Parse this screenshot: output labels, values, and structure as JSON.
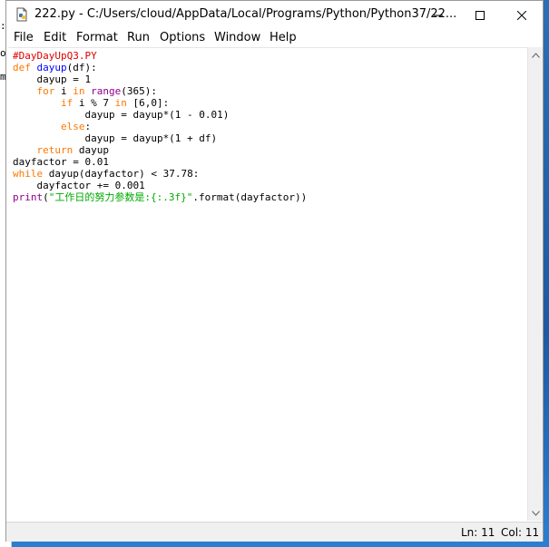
{
  "window": {
    "title": "222.py - C:/Users/cloud/AppData/Local/Programs/Python/Python37/22...",
    "icon": "python-file-icon"
  },
  "background_window": {
    "fragments": [
      ":",
      "o",
      "ma"
    ]
  },
  "menu": [
    "File",
    "Edit",
    "Format",
    "Run",
    "Options",
    "Window",
    "Help"
  ],
  "code_lines": [
    [
      {
        "t": "#DayDayUpQ3.PY",
        "c": "cm"
      }
    ],
    [
      {
        "t": "def",
        "c": "kw"
      },
      {
        "t": " "
      },
      {
        "t": "dayup",
        "c": "fn"
      },
      {
        "t": "(df):"
      }
    ],
    [
      {
        "t": "    dayup = 1"
      }
    ],
    [
      {
        "t": "    "
      },
      {
        "t": "for",
        "c": "kw"
      },
      {
        "t": " i "
      },
      {
        "t": "in",
        "c": "kw"
      },
      {
        "t": " "
      },
      {
        "t": "range",
        "c": "bi"
      },
      {
        "t": "(365):"
      }
    ],
    [
      {
        "t": "        "
      },
      {
        "t": "if",
        "c": "kw"
      },
      {
        "t": " i % 7 "
      },
      {
        "t": "in",
        "c": "kw"
      },
      {
        "t": " [6,0]:"
      }
    ],
    [
      {
        "t": "            dayup = dayup*(1 - 0.01)"
      }
    ],
    [
      {
        "t": "        "
      },
      {
        "t": "else",
        "c": "kw"
      },
      {
        "t": ":"
      }
    ],
    [
      {
        "t": "            dayup = dayup*(1 + df)"
      }
    ],
    [
      {
        "t": "    "
      },
      {
        "t": "return",
        "c": "kw"
      },
      {
        "t": " dayup"
      }
    ],
    [
      {
        "t": "dayfactor = 0.01"
      }
    ],
    [
      {
        "t": "while",
        "c": "kw"
      },
      {
        "t": " dayup(dayfactor) < 37.78:"
      }
    ],
    [
      {
        "t": "    dayfactor += 0.001"
      }
    ],
    [
      {
        "t": "print",
        "c": "bi"
      },
      {
        "t": "("
      },
      {
        "t": "\"工作日的努力参数是:{:.3f}\"",
        "c": "st"
      },
      {
        "t": ".format(dayfactor))"
      }
    ]
  ],
  "status": {
    "line": "Ln: 11",
    "col": "Col: 11"
  }
}
